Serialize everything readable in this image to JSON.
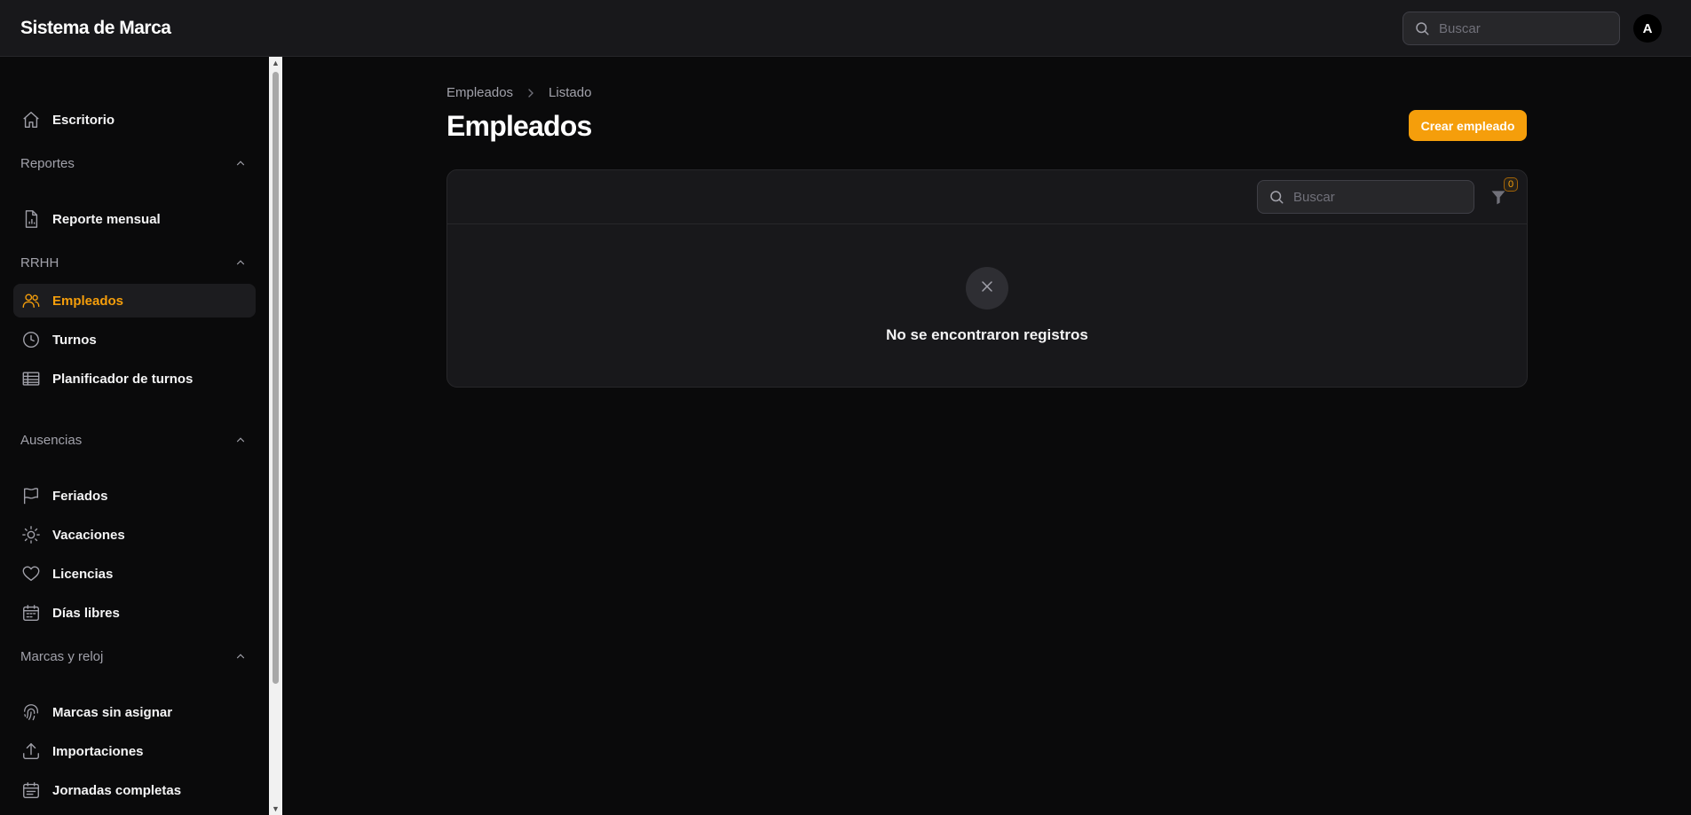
{
  "app": {
    "brand": "Sistema de Marca",
    "search_placeholder": "Buscar",
    "avatar_initial": "A"
  },
  "sidebar": {
    "dashboard": {
      "label": "Escritorio",
      "icon": "home-icon"
    },
    "groups": [
      {
        "label": "Reportes",
        "items": [
          {
            "label": "Reporte mensual",
            "icon": "document-chart-icon"
          }
        ]
      },
      {
        "label": "RRHH",
        "items": [
          {
            "label": "Empleados",
            "icon": "users-icon",
            "active": true
          },
          {
            "label": "Turnos",
            "icon": "clock-icon"
          },
          {
            "label": "Planificador de turnos",
            "icon": "table-icon"
          }
        ]
      },
      {
        "label": "Ausencias",
        "items": [
          {
            "label": "Feriados",
            "icon": "flag-icon"
          },
          {
            "label": "Vacaciones",
            "icon": "sun-icon"
          },
          {
            "label": "Licencias",
            "icon": "heart-icon"
          },
          {
            "label": "Días libres",
            "icon": "calendar-icon"
          }
        ]
      },
      {
        "label": "Marcas y reloj",
        "items": [
          {
            "label": "Marcas sin asignar",
            "icon": "fingerprint-icon"
          },
          {
            "label": "Importaciones",
            "icon": "upload-icon"
          },
          {
            "label": "Jornadas completas",
            "icon": "calendar-days-icon"
          }
        ]
      }
    ]
  },
  "main": {
    "breadcrumb": [
      "Empleados",
      "Listado"
    ],
    "title": "Empleados",
    "create_button": "Crear empleado",
    "table": {
      "search_placeholder": "Buscar",
      "filter_count": "0",
      "empty_message": "No se encontraron registros"
    }
  },
  "colors": {
    "accent": "#f59e0b",
    "background": "#0a0a0b",
    "surface": "#18181b"
  }
}
